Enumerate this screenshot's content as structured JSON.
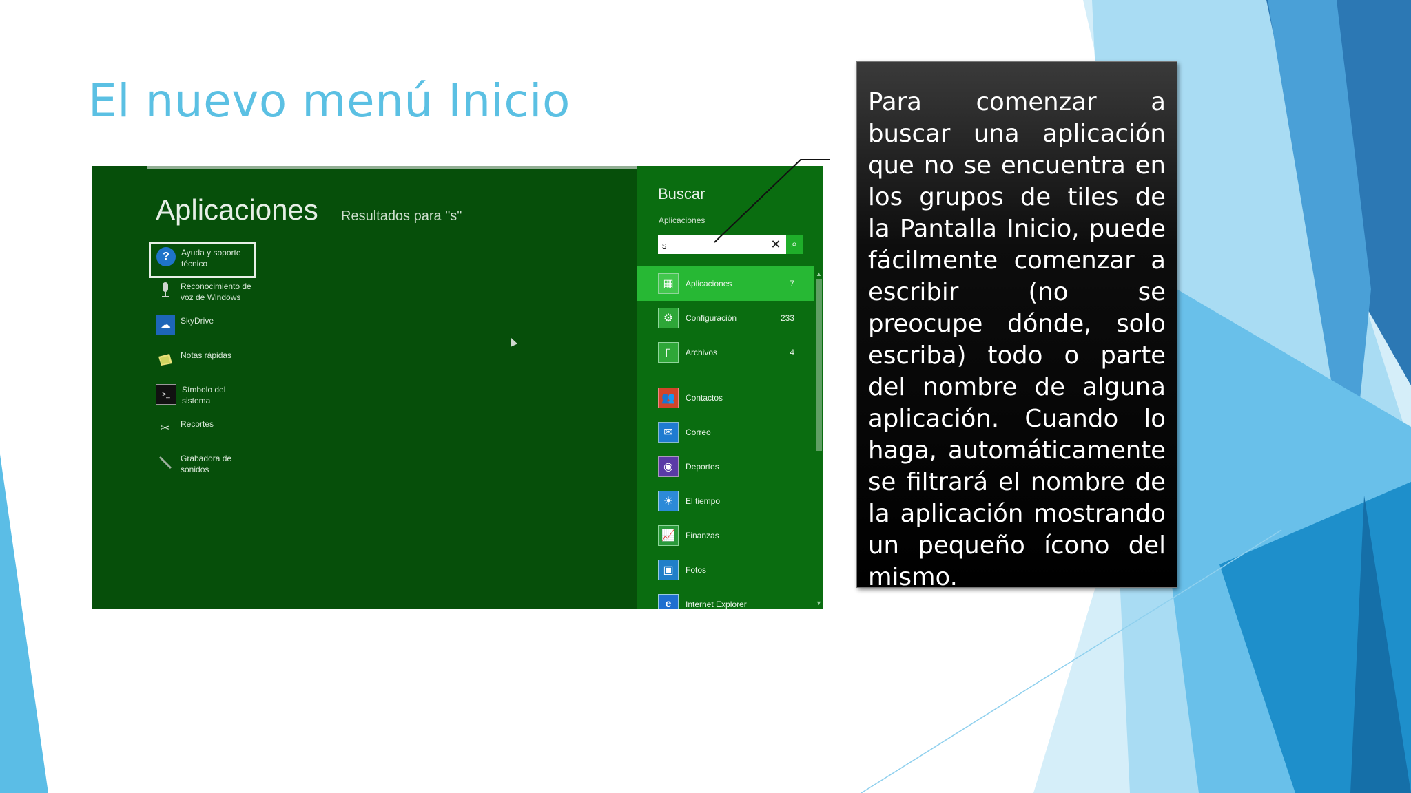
{
  "slide": {
    "title": "El nuevo menú Inicio",
    "accent_color": "#5bc0e3",
    "caption": "Para comenzar a buscar una aplicación que no se encuentra en los grupos de tiles de la Pantalla Inicio, puede fácilmente comenzar a escribir (no se preocupe dónde, solo escriba) todo o parte del nombre de alguna aplicación. Cuando lo haga, automáticamente se filtrará el nombre de la aplicación mostrando un pequeño ícono del mismo."
  },
  "screenshot": {
    "heading": "Aplicaciones",
    "results_label": "Resultados para \"s\"",
    "apps": [
      {
        "label": "Ayuda y soporte técnico",
        "icon": "help-icon",
        "selected": true
      },
      {
        "label": "Reconocimiento de voz de Windows",
        "icon": "microphone-icon",
        "selected": false
      },
      {
        "label": "SkyDrive",
        "icon": "cloud-icon",
        "selected": false
      },
      {
        "label": "Notas rápidas",
        "icon": "sticky-note-icon",
        "selected": false
      },
      {
        "label": "Símbolo del sistema",
        "icon": "terminal-icon",
        "selected": false
      },
      {
        "label": "Recortes",
        "icon": "scissors-icon",
        "selected": false
      },
      {
        "label": "Grabadora de sonidos",
        "icon": "recorder-icon",
        "selected": false
      }
    ],
    "search": {
      "title": "Buscar",
      "scope_label": "Aplicaciones",
      "query": "s",
      "clear_glyph": "✕",
      "go_glyph": "⌕"
    },
    "scopes": [
      {
        "label": "Aplicaciones",
        "count": "7",
        "icon": "apps-icon",
        "active": true
      },
      {
        "label": "Configuración",
        "count": "233",
        "icon": "settings-icon",
        "active": false
      },
      {
        "label": "Archivos",
        "count": "4",
        "icon": "file-icon",
        "active": false
      },
      {
        "label": "Contactos",
        "count": "",
        "icon": "people-icon",
        "active": false
      },
      {
        "label": "Correo",
        "count": "",
        "icon": "mail-icon",
        "active": false
      },
      {
        "label": "Deportes",
        "count": "",
        "icon": "sports-icon",
        "active": false
      },
      {
        "label": "El tiempo",
        "count": "",
        "icon": "weather-icon",
        "active": false
      },
      {
        "label": "Finanzas",
        "count": "",
        "icon": "finance-icon",
        "active": false
      },
      {
        "label": "Fotos",
        "count": "",
        "icon": "photos-icon",
        "active": false
      },
      {
        "label": "Internet Explorer",
        "count": "",
        "icon": "ie-icon",
        "active": false
      }
    ]
  }
}
